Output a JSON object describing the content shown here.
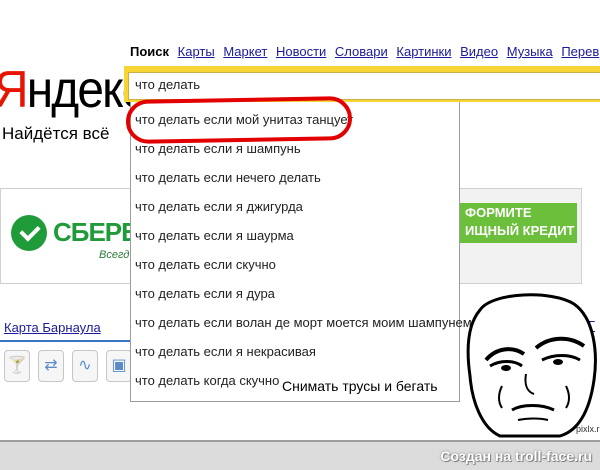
{
  "logo": {
    "first_letter": "Я",
    "rest": "ндекс"
  },
  "slogan": "Найдётся всё",
  "tabs": [
    {
      "label": "Поиск",
      "active": true
    },
    {
      "label": "Карты",
      "active": false
    },
    {
      "label": "Маркет",
      "active": false
    },
    {
      "label": "Новости",
      "active": false
    },
    {
      "label": "Словари",
      "active": false
    },
    {
      "label": "Картинки",
      "active": false
    },
    {
      "label": "Видео",
      "active": false
    },
    {
      "label": "Музыка",
      "active": false
    },
    {
      "label": "Перев",
      "active": false
    }
  ],
  "search": {
    "value": "что делать"
  },
  "suggestions": [
    "что делать если мой унитаз танцует",
    "что делать если я шампунь",
    "что делать если нечего делать",
    "что делать если я джигурда",
    "что делать если я шаурма",
    "что делать если скучно",
    "что делать если я дура",
    "что делать если волан де морт моется моим шампунем",
    "что делать если я некрасивая",
    "что делать когда скучно"
  ],
  "caption": "Снимать трусы и бегать",
  "banner_left": {
    "brand": "СБЕРБА",
    "sub": "Всегд"
  },
  "banner_right": {
    "line1": "ФОРМИТЕ",
    "line2": "ИЩНЫЙ КРЕДИТ"
  },
  "map": {
    "link": "Карта Барнаула",
    "icons": [
      "cocktail-icon",
      "transit-icon",
      "route-icon",
      "car-icon"
    ]
  },
  "right_sliver": "Г",
  "watermark": "pixlx.ru",
  "footer": "Создан на troll-face.ru",
  "colors": {
    "search_border": "#f7d532",
    "logo_red": "#e61400",
    "sber_green": "#1f9b39",
    "highlight_red": "#e20000",
    "link_blue": "#1a1a9a"
  }
}
